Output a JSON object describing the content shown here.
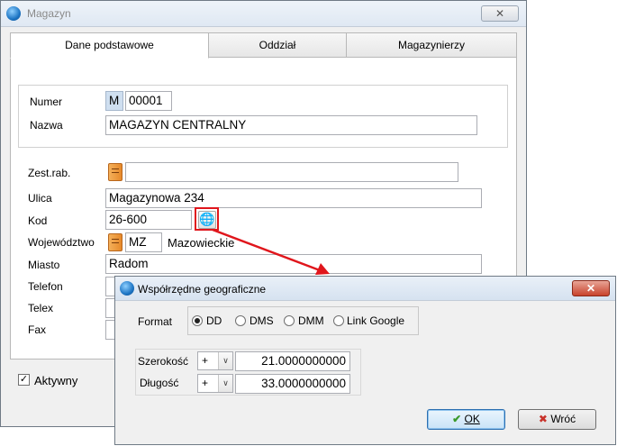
{
  "main_window": {
    "title": "Magazyn",
    "close_glyph": "✕",
    "tabs": [
      {
        "label": "Dane podstawowe",
        "active": true
      },
      {
        "label": "Oddział",
        "active": false
      },
      {
        "label": "Magazynierzy",
        "active": false
      }
    ],
    "fields": {
      "numer": {
        "label": "Numer",
        "prefix": "M",
        "value": "00001"
      },
      "nazwa": {
        "label": "Nazwa",
        "value": "MAGAZYN CENTRALNY"
      },
      "zest_rab": {
        "label": "Zest.rab.",
        "value": ""
      },
      "ulica": {
        "label": "Ulica",
        "value": "Magazynowa 234"
      },
      "kod": {
        "label": "Kod",
        "value": "26-600"
      },
      "wojewodztwo": {
        "label": "Województwo",
        "code": "MZ",
        "name": "Mazowieckie"
      },
      "miasto": {
        "label": "Miasto",
        "value": "Radom"
      },
      "telefon": {
        "label": "Telefon",
        "value": ""
      },
      "telex": {
        "label": "Telex",
        "value": ""
      },
      "fax": {
        "label": "Fax",
        "value": ""
      }
    },
    "aktywny": {
      "label": "Aktywny",
      "checked": true,
      "check_glyph": "✓"
    },
    "icons": {
      "app": "app-logo-icon",
      "book": "book-icon",
      "globe": "globe-icon",
      "globe_glyph": "🌐"
    }
  },
  "dialog": {
    "title": "Współrzędne geograficzne",
    "close_glyph": "✕",
    "format_label": "Format",
    "format_options": [
      {
        "label": "DD",
        "selected": true
      },
      {
        "label": "DMS",
        "selected": false
      },
      {
        "label": "DMM",
        "selected": false
      },
      {
        "label": "Link Google",
        "selected": false
      }
    ],
    "szerokosc": {
      "label": "Szerokość",
      "sign": "+",
      "value": "21.0000000000"
    },
    "dlugosc": {
      "label": "Długość",
      "sign": "+",
      "value": "33.0000000000"
    },
    "dropdown_glyph": "∨",
    "ok_label": "OK",
    "ok_glyph": "✔",
    "cancel_label": "Wróć",
    "cancel_glyph": "✖"
  },
  "colors": {
    "highlight": "#e0161c",
    "accent": "#2d6fb0"
  }
}
